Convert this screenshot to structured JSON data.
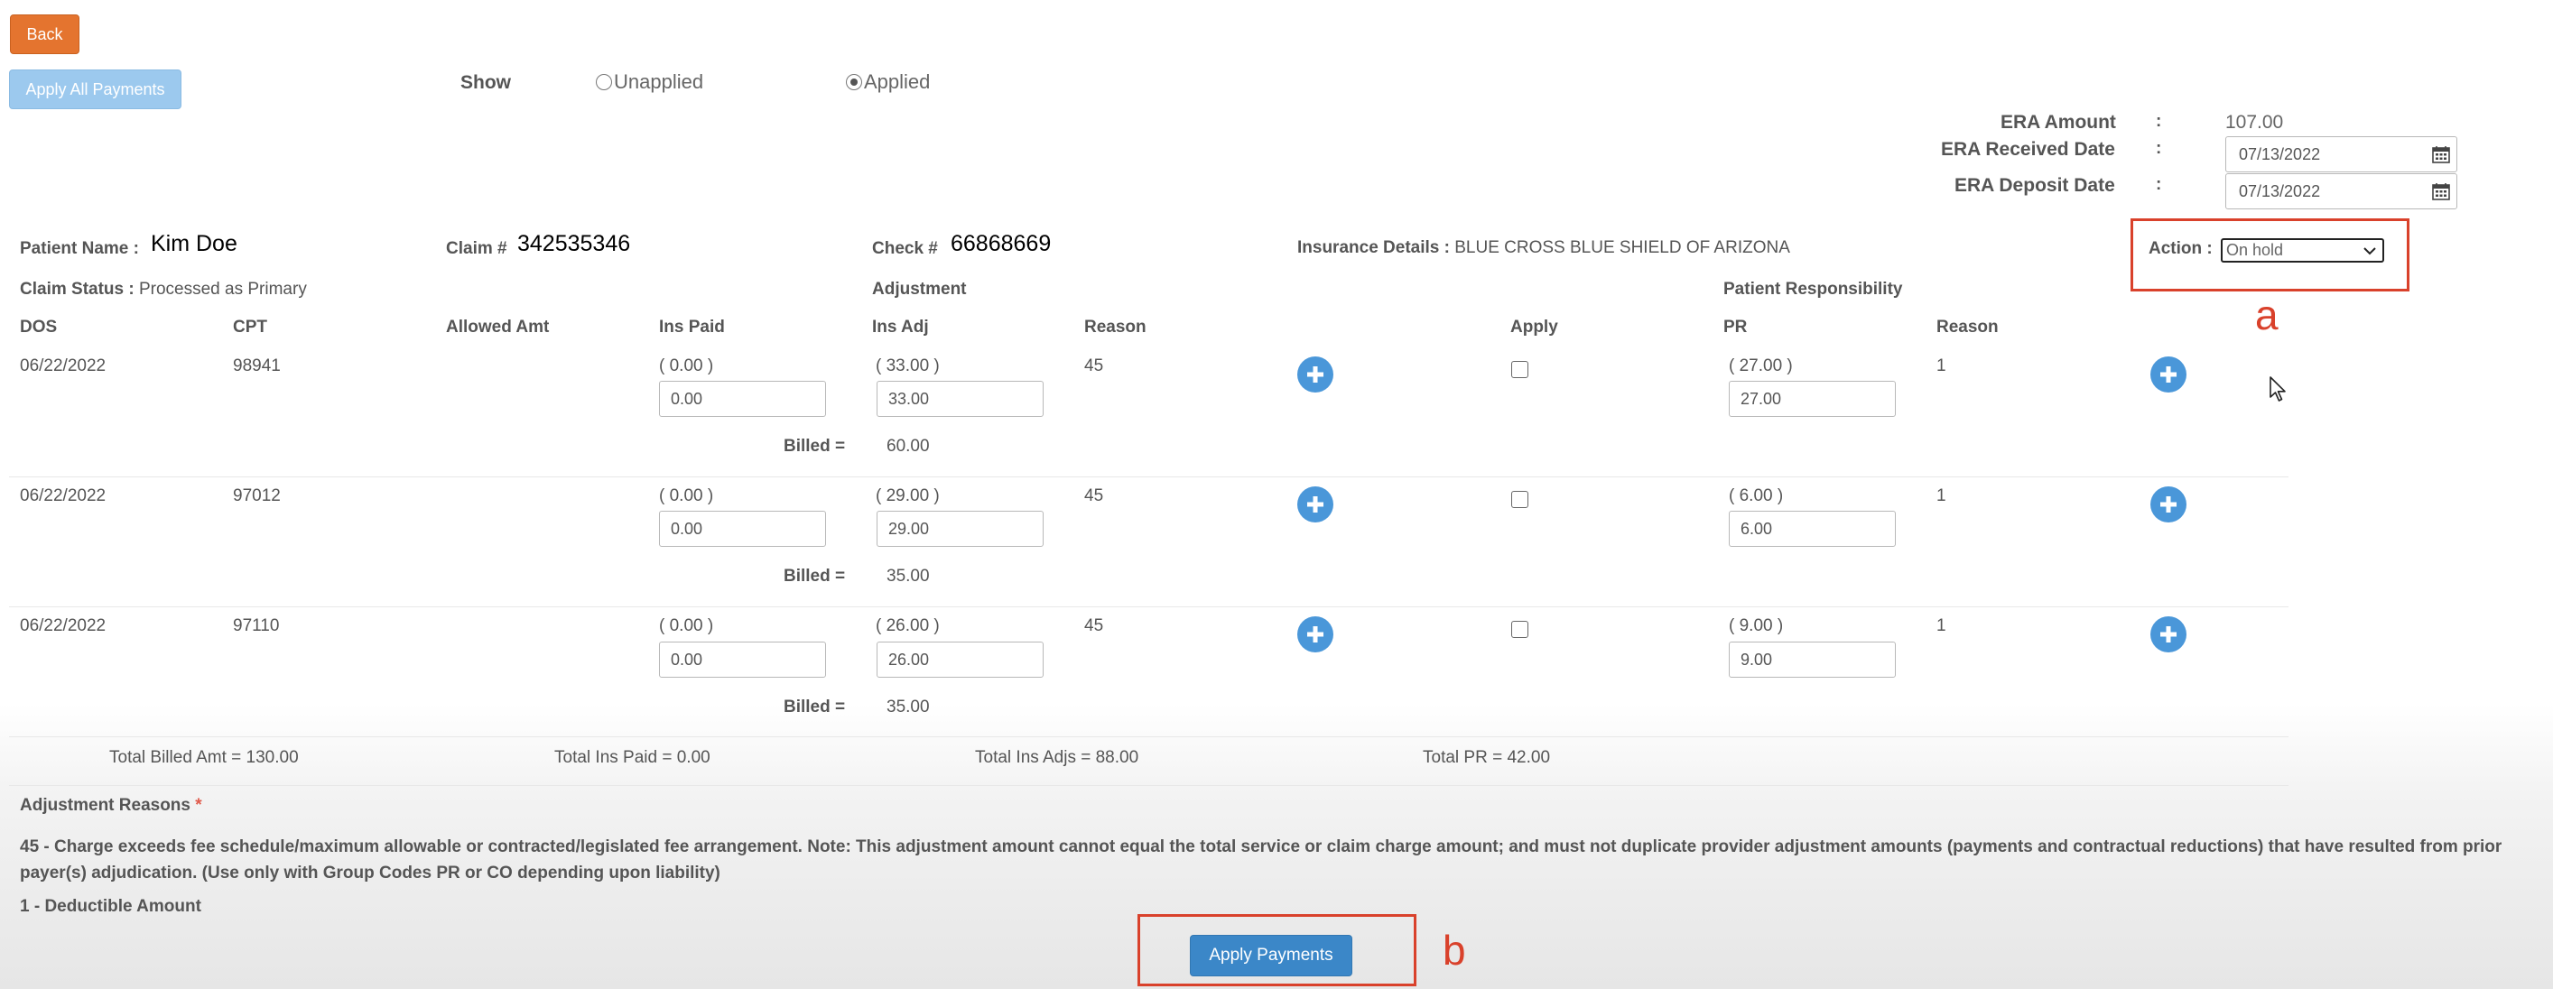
{
  "toolbar": {
    "back_label": "Back",
    "apply_all_label": "Apply All Payments",
    "show_label": "Show",
    "filter_options": [
      {
        "label": "Unapplied",
        "checked": false
      },
      {
        "label": "Applied",
        "checked": true
      }
    ]
  },
  "era": {
    "amount_label": "ERA Amount",
    "received_label": "ERA Received Date",
    "deposit_label": "ERA Deposit Date",
    "sep": ":",
    "amount_value": "107.00",
    "received_value": "07/13/2022",
    "deposit_value": "07/13/2022"
  },
  "claim": {
    "patient_label": "Patient Name :",
    "patient_value": "Kim Doe",
    "claim_label": "Claim #",
    "claim_value": "342535346",
    "check_label": "Check #",
    "check_value": "66868669",
    "insurance_label": "Insurance Details :",
    "insurance_value": "BLUE CROSS BLUE SHIELD OF ARIZONA",
    "action_label": "Action :",
    "action_value": "On hold",
    "status_label": "Claim Status :",
    "status_value": "Processed as Primary"
  },
  "headers": {
    "adjustment_group": "Adjustment",
    "patient_resp_group": "Patient Responsibility",
    "dos": "DOS",
    "cpt": "CPT",
    "allowed": "Allowed Amt",
    "ins_paid": "Ins Paid",
    "ins_adj": "Ins Adj",
    "reason": "Reason",
    "apply": "Apply",
    "pr": "PR",
    "reason2": "Reason"
  },
  "billed_label": "Billed =",
  "rows": [
    {
      "dos": "06/22/2022",
      "cpt": "98941",
      "ins_paid_orig": "( 0.00 )",
      "ins_paid": "0.00",
      "ins_adj_orig": "( 33.00 )",
      "ins_adj": "33.00",
      "reason": "45",
      "pr_orig": "( 27.00 )",
      "pr": "27.00",
      "pr_reason": "1",
      "billed": "60.00"
    },
    {
      "dos": "06/22/2022",
      "cpt": "97012",
      "ins_paid_orig": "( 0.00 )",
      "ins_paid": "0.00",
      "ins_adj_orig": "( 29.00 )",
      "ins_adj": "29.00",
      "reason": "45",
      "pr_orig": "( 6.00 )",
      "pr": "6.00",
      "pr_reason": "1",
      "billed": "35.00"
    },
    {
      "dos": "06/22/2022",
      "cpt": "97110",
      "ins_paid_orig": "( 0.00 )",
      "ins_paid": "0.00",
      "ins_adj_orig": "( 26.00 )",
      "ins_adj": "26.00",
      "reason": "45",
      "pr_orig": "( 9.00 )",
      "pr": "9.00",
      "pr_reason": "1",
      "billed": "35.00"
    }
  ],
  "totals": {
    "billed": "Total Billed Amt = 130.00",
    "ins_paid": "Total Ins Paid = 0.00",
    "ins_adjs": "Total Ins Adjs = 88.00",
    "pr": "Total PR = 42.00"
  },
  "adjustment_reasons": {
    "title": "Adjustment Reasons",
    "required_mark": "*",
    "reason_45": "45 - Charge exceeds fee schedule/maximum allowable or contracted/legislated fee arrangement. Note: This adjustment amount cannot equal the total service or claim charge amount; and must not duplicate provider adjustment amounts (payments and contractual reductions) that have resulted from prior payer(s) adjudication. (Use only with Group Codes PR or CO depending upon liability)",
    "reason_1": "1 - Deductible Amount"
  },
  "apply_payments_label": "Apply Payments",
  "annotations": {
    "a": "a",
    "b": "b"
  },
  "colors": {
    "back_button": "#e4742f",
    "apply_button": "#3b87c8",
    "plus_icon": "#4a97d9",
    "highlight_box": "#d9412b"
  }
}
